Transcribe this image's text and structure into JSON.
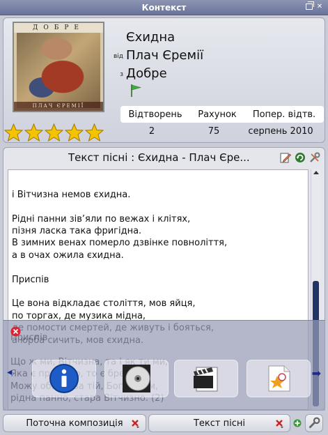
{
  "window": {
    "title": "Контекст"
  },
  "current_track": {
    "cover_top_text": "ДОБРЕ",
    "cover_bottom_text": "ПЛАЧ ЄРЕМІЇ",
    "title": "Єхидна",
    "artist_prefix": "від",
    "artist": "Плач Єремії",
    "album_prefix": "з",
    "album": "Добре",
    "rating_stars": 5,
    "stats_headers": [
      "Відтворень",
      "Рахунок",
      "Попер. відтв."
    ],
    "stats_values": [
      "2",
      "75",
      "серпень 2010"
    ]
  },
  "lyrics": {
    "header": "Текст пісні : Єхидна - Плач Єре...",
    "text": "і Вітчизна немов єхидна.\n\nРідні панни зів’яли по вежах і клітях,\nпізня ласка така фригідна.\nВ зимних венах померло дзвінке повноліття,\nа в очах ожила єхидна.\n\nПриспів\n\nЦе вона відкладає століття, мов яйця,\nпо торгах, де музика мідна,\nде помости смертей, де живуть і бояться,\nа юрба сичить, мов єхидна.",
    "overlay_text": "Приспів\n\nЩо ж ми, Вітчизна, та і як ти ми,\nЯка є правдою, то є брехня,\nМожу обійти за тій, Бог нуном,\nрідна панно, стара Вітчизно. (2)",
    "tool_icons": [
      "edit-icon",
      "refresh-icon",
      "settings-icon"
    ]
  },
  "applet_tray": {
    "tiles": [
      "info-icon",
      "cd-icon",
      "video-clapper-icon",
      "favorite-document-icon"
    ]
  },
  "bottom_tabs": [
    {
      "label": "Поточна композиція"
    },
    {
      "label": "Текст пісні"
    }
  ],
  "colors": {
    "titlebar": "#7a82a5",
    "accent_blue": "#1c2c88",
    "star": "#f5c400"
  }
}
